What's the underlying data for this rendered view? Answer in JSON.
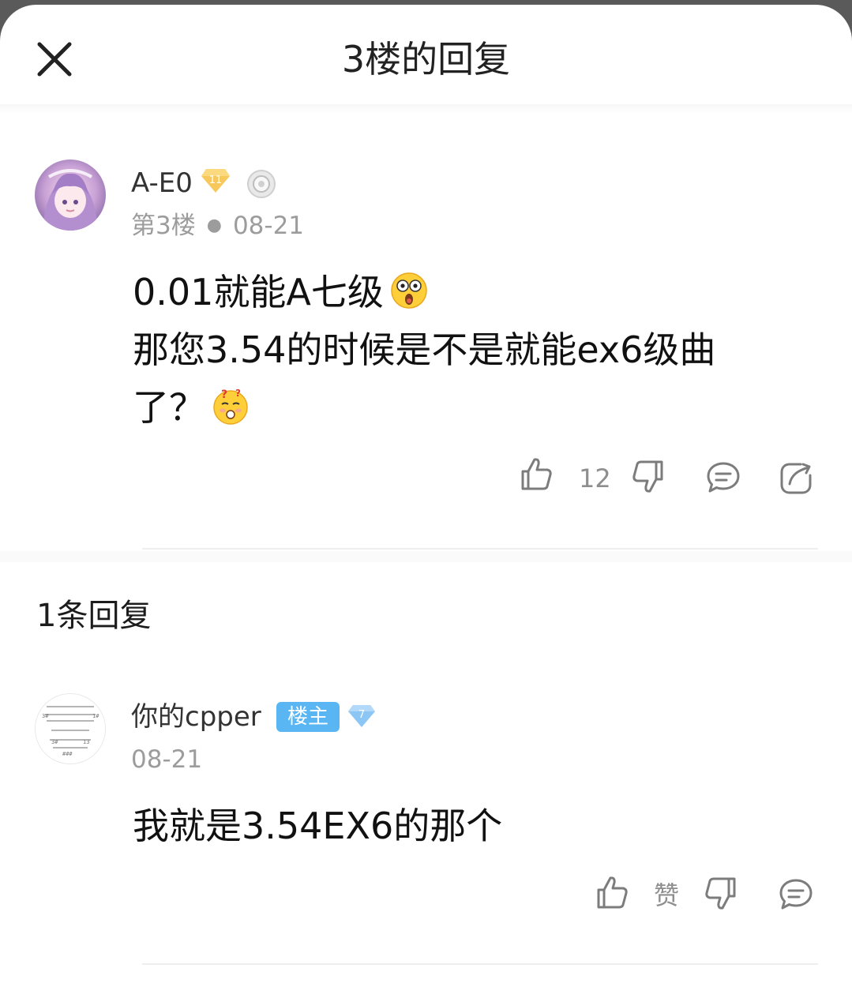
{
  "header": {
    "title": "3楼的回复",
    "close_icon": "close-icon"
  },
  "post": {
    "username": "A-E0",
    "level_badge": "11",
    "floor": "第3楼",
    "date": "08-21",
    "content_lines": [
      "0.01就能A七级",
      "那您3.54的时候是不是就能ex6级曲",
      "了？"
    ],
    "like_count": "12"
  },
  "replies": {
    "title": "1条回复",
    "items": [
      {
        "username": "你的cpper",
        "op_label": "楼主",
        "level_badge": "7",
        "date": "08-21",
        "content": "我就是3.54EX6的那个",
        "like_label": "赞"
      }
    ]
  },
  "colors": {
    "accent_blue": "#59b6f3",
    "meta_gray": "#9c9c9c",
    "level_gold": "#f7c85c",
    "level_blue": "#8cc6f5"
  }
}
